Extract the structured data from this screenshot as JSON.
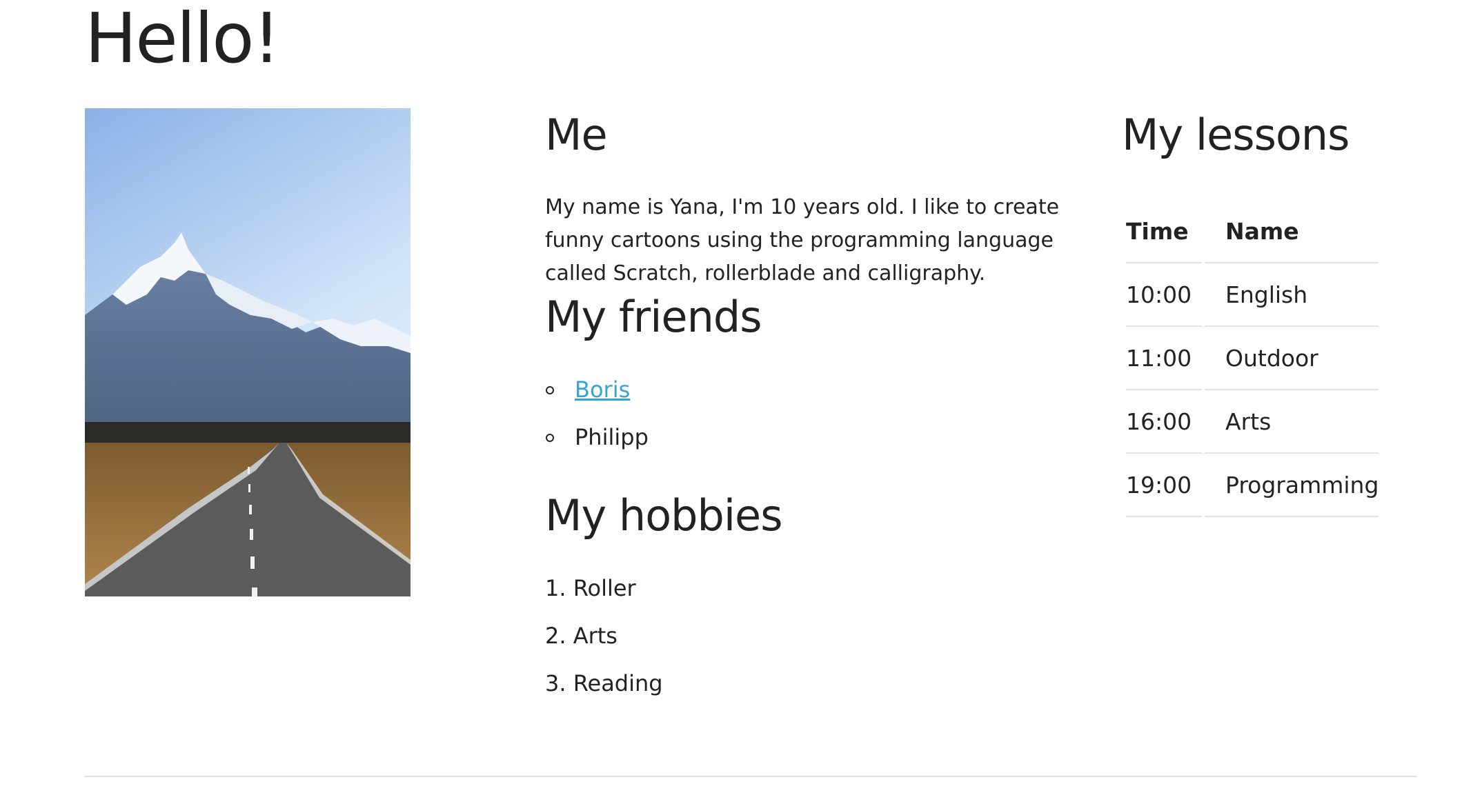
{
  "page": {
    "title": "Hello!"
  },
  "photo": {
    "subject": "mountain road landscape",
    "colors": {
      "sky_top": "#8fb3e6",
      "sky_bottom": "#e6f1fb",
      "road": "#5d5d5d",
      "grass": "#a47a43"
    }
  },
  "about": {
    "heading": "Me",
    "text": "My name is Yana, I'm 10 years old. I like to create funny cartoons using the programming language called Scratch, rollerblade and calligraphy."
  },
  "friends": {
    "heading": "My friends",
    "items": [
      {
        "name": "Boris",
        "is_link": true
      },
      {
        "name": "Philipp",
        "is_link": false
      }
    ]
  },
  "hobbies": {
    "heading": "My hobbies",
    "items": [
      "1. Roller",
      "2. Arts",
      "3. Reading"
    ]
  },
  "lessons": {
    "heading": "My lessons",
    "columns": [
      "Time",
      "Name"
    ],
    "rows": [
      {
        "time": "10:00",
        "name": "English"
      },
      {
        "time": "11:00",
        "name": "Outdoor"
      },
      {
        "time": "16:00",
        "name": "Arts"
      },
      {
        "time": "19:00",
        "name": "Programming"
      }
    ]
  },
  "colors": {
    "text": "#222222",
    "link": "#33a6cf",
    "rule": "#e1e1e1",
    "background": "#ffffff"
  }
}
